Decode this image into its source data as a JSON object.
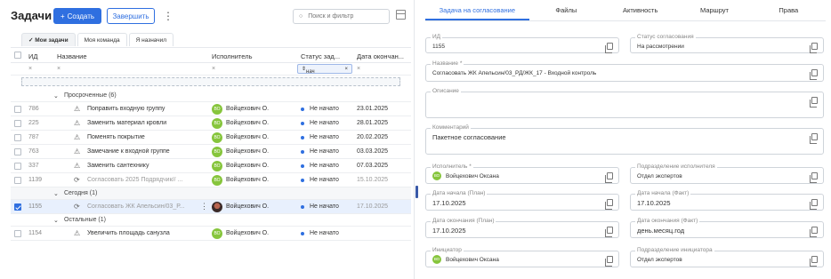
{
  "header": {
    "title": "Задачи",
    "create_label": "Создать",
    "finish_label": "Завершить",
    "search_placeholder": "Поиск и фильтр"
  },
  "view_tabs": [
    "Мои задачи",
    "Моя команда",
    "Я назначил"
  ],
  "columns": {
    "name": "Название",
    "executor": "Исполнитель",
    "status": "Статус зад...",
    "due": "Дата окончан..."
  },
  "filters": {
    "status_value": "нач"
  },
  "groups": [
    {
      "label": "Просроченные (6)",
      "rows": [
        {
          "id": "786",
          "name": "Поправить входную группу",
          "executor": "Войцехович О.",
          "status": "Не начато",
          "date": "23.01.2025"
        },
        {
          "id": "225",
          "name": "Заменить материал кровли",
          "executor": "Войцехович О.",
          "status": "Не начато",
          "date": "28.01.2025"
        },
        {
          "id": "787",
          "name": "Поменять покрытие",
          "executor": "Войцехович О.",
          "status": "Не начато",
          "date": "20.02.2025"
        },
        {
          "id": "763",
          "name": "Замечание к входной группе",
          "executor": "Войцехович О.",
          "status": "Не начато",
          "date": "03.03.2025"
        },
        {
          "id": "337",
          "name": "Заменить сантехнику",
          "executor": "Войцехович О.",
          "status": "Не начато",
          "date": "07.03.2025"
        },
        {
          "id": "1139",
          "name": "Согласовать 2025 Подрядчик// ...",
          "executor": "Войцехович О.",
          "status": "Не начато",
          "date": "15.10.2025"
        }
      ]
    },
    {
      "label": "Сегодня (1)",
      "rows": [
        {
          "id": "1155",
          "name": "Согласовать ЖК Апельсин/03_Р...",
          "executor": "Войцехович О.",
          "status": "Не начато",
          "date": "17.10.2025"
        }
      ]
    },
    {
      "label": "Остальные (1)",
      "rows": [
        {
          "id": "1154",
          "name": "Увеличить площадь санузла",
          "executor": "Войцехович О.",
          "status": "Не начато",
          "date": ""
        }
      ]
    }
  ],
  "avatar_initials": "ВО",
  "detail": {
    "tabs": [
      "Задача на согласование",
      "Файлы",
      "Активность",
      "Маршрут",
      "Права"
    ],
    "fields": {
      "id": {
        "label": "ИД",
        "value": "1155"
      },
      "approval_status": {
        "label": "Статус согласования",
        "value": "На рассмотрении"
      },
      "name": {
        "label": "Название *",
        "value": "Согласовать ЖК Апельсин/03_РД/ЖК_17 - Входной контроль"
      },
      "description": {
        "label": "Описание",
        "value": ""
      },
      "comment": {
        "label": "Комментарий",
        "value": "Пакетное согласование"
      },
      "executor": {
        "label": "Исполнитель *",
        "value": "Войцехович Оксана"
      },
      "executor_dept": {
        "label": "Подразделение исполнителя",
        "value": "Отдел экспертов"
      },
      "start_plan": {
        "label": "Дата начала (План)",
        "value": "17.10.2025"
      },
      "start_fact": {
        "label": "Дата начала (Факт)",
        "value": "17.10.2025"
      },
      "end_plan": {
        "label": "Дата окончания (План)",
        "value": "17.10.2025"
      },
      "end_fact": {
        "label": "Дата окончания (Факт)",
        "value": "день.месяц.год"
      },
      "initiator": {
        "label": "Инициатор",
        "value": "Войцехович Оксана"
      },
      "initiator_dept": {
        "label": "Подразделение инициатора",
        "value": "Отдел экспертов"
      }
    }
  }
}
